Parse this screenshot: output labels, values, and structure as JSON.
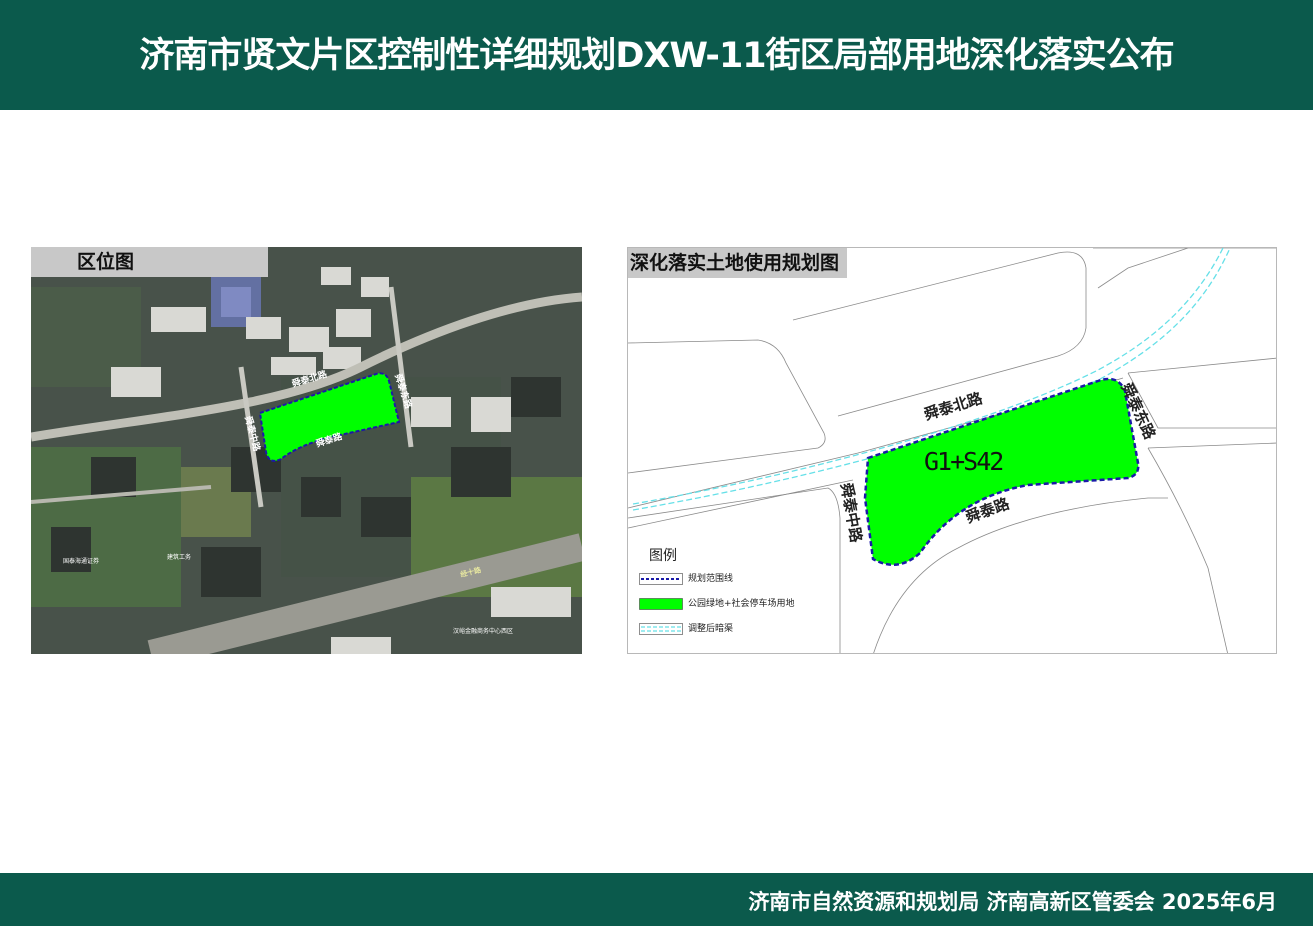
{
  "header": {
    "title": "济南市贤文片区控制性详细规划DXW-11街区局部用地深化落实公布"
  },
  "location_map": {
    "title": "区位图",
    "labels": {
      "road_north": "舜泰北路",
      "road_east": "舜泰东路",
      "road_middle": "舜泰中路",
      "road_south": "舜泰路",
      "poi_1": "国泰海通证券",
      "poi_2": "建筑工务",
      "poi_3": "汉峪金融商务中心西区",
      "expressway": "经十路"
    },
    "colors": {
      "site": "#00ff00",
      "boundary": "#1a1aa8"
    }
  },
  "plan_map": {
    "title": "深化落实土地使用规划图",
    "parcel_code": "G1+S42",
    "roads": {
      "north": "舜泰北路",
      "east": "舜泰东路",
      "middle": "舜泰中路",
      "south": "舜泰路"
    },
    "legend": {
      "title": "图例",
      "items": [
        {
          "label": "规划范围线",
          "symbol": "blue-dashed-line"
        },
        {
          "label": "公园绿地+社会停车场用地",
          "symbol": "green-fill",
          "color": "#00ff00"
        },
        {
          "label": "调整后暗渠",
          "symbol": "cyan-double-dashed-line",
          "color": "#66e0e8"
        }
      ]
    }
  },
  "footer": {
    "text": "济南市自然资源和规划局  济南高新区管委会  2025年6月"
  }
}
